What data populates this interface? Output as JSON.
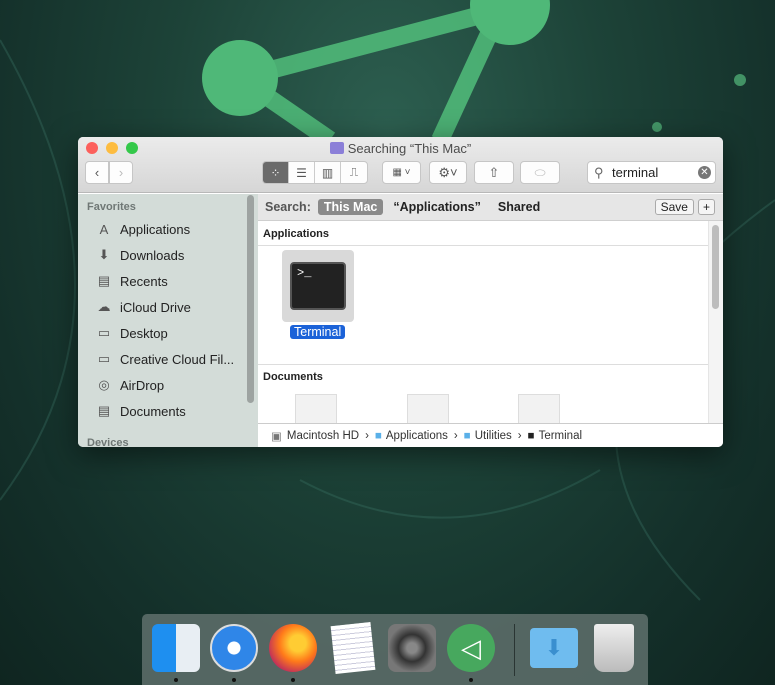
{
  "window": {
    "title": "Searching “This Mac”"
  },
  "toolbar": {
    "search_value": "terminal"
  },
  "search_bar": {
    "label": "Search:",
    "scopes": [
      "This Mac",
      "“Applications”",
      "Shared"
    ],
    "save_label": "Save",
    "add_label": "+"
  },
  "sidebar": {
    "favorites_header": "Favorites",
    "devices_header": "Devices",
    "items": [
      {
        "label": "Applications",
        "icon": "A"
      },
      {
        "label": "Downloads",
        "icon": "⬇"
      },
      {
        "label": "Recents",
        "icon": "▤"
      },
      {
        "label": "iCloud Drive",
        "icon": "☁"
      },
      {
        "label": "Desktop",
        "icon": "▭"
      },
      {
        "label": "Creative Cloud Fil...",
        "icon": "▭"
      },
      {
        "label": "AirDrop",
        "icon": "◎"
      },
      {
        "label": "Documents",
        "icon": "▤"
      }
    ]
  },
  "results": {
    "applications_header": "Applications",
    "documents_header": "Documents",
    "app_item": "Terminal"
  },
  "path_bar": [
    "Macintosh HD",
    "Applications",
    "Utilities",
    "Terminal"
  ],
  "dock": [
    "Finder",
    "Safari",
    "Firefox",
    "TextEdit",
    "System Preferences",
    "ProtonVPN",
    "Downloads",
    "Trash"
  ]
}
